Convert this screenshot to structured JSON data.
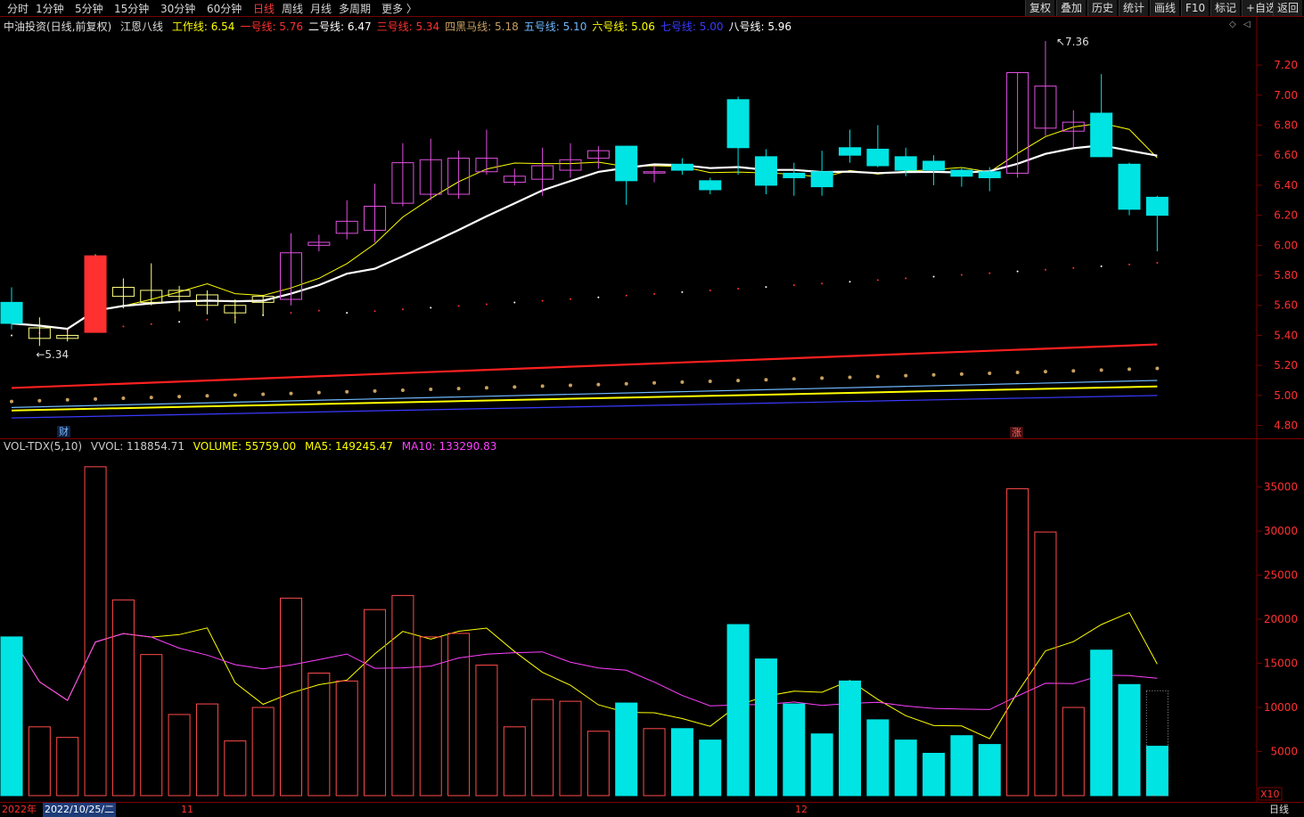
{
  "toolbar": {
    "periods": [
      "分时",
      "1分钟",
      "5分钟",
      "15分钟",
      "30分钟",
      "60分钟",
      "日线",
      "周线",
      "月线",
      "多周期",
      "更多 〉"
    ],
    "active": "日线",
    "right_buttons": [
      "复权",
      "叠加",
      "历史",
      "统计",
      "画线",
      "F10",
      "标记",
      "+自选",
      "返回"
    ]
  },
  "info": {
    "stock": "中油投资(日线,前复权)",
    "indicator": "江恩八线",
    "lines": [
      {
        "label": "工作线:",
        "value": "6.54",
        "color": "#ffff00"
      },
      {
        "label": "一号线:",
        "value": "5.76",
        "color": "#ff3030"
      },
      {
        "label": "二号线:",
        "value": "6.47",
        "color": "#ffffff"
      },
      {
        "label": "三号线:",
        "value": "5.34",
        "color": "#ff3030"
      },
      {
        "label": "四黑马线:",
        "value": "5.18",
        "color": "#c8a060"
      },
      {
        "label": "五号线:",
        "value": "5.10",
        "color": "#6fb8ff"
      },
      {
        "label": "六号线:",
        "value": "5.06",
        "color": "#ffff00"
      },
      {
        "label": "七号线:",
        "value": "5.00",
        "color": "#3a3aff"
      },
      {
        "label": "八号线:",
        "value": "5.96",
        "color": "#ffffff"
      }
    ]
  },
  "volume_info": {
    "name": "VOL-TDX(5,10)",
    "vvol": "VVOL: 118854.71",
    "volume": "VOLUME: 55759.00",
    "ma5": "MA5: 149245.47",
    "ma10": "MA10: 133290.83",
    "colors": {
      "name": "#cccccc",
      "vvol": "#cccccc",
      "volume": "#ffff00",
      "ma5": "#ffff00",
      "ma10": "#ff40ff"
    }
  },
  "annotations": {
    "high": "7.36",
    "low": "5.34",
    "cai": "财",
    "zhang": "涨"
  },
  "price_axis": [
    "7.20",
    "7.00",
    "6.80",
    "6.60",
    "6.40",
    "6.20",
    "6.00",
    "5.80",
    "5.60",
    "5.40",
    "5.20",
    "5.00",
    "4.80"
  ],
  "volume_axis": [
    "35000",
    "30000",
    "25000",
    "20000",
    "15000",
    "10000",
    "5000"
  ],
  "volume_unit": "X10",
  "bottom": {
    "year": "2022年",
    "cursor_date": "2022/10/25/二",
    "m11": "11",
    "m12": "12",
    "period": "日线"
  },
  "colors": {
    "up": "#ff3030",
    "down": "#00e4e4",
    "up_small": "#e050e0",
    "grid": "#7a0000",
    "yellow": "#ffff00",
    "magenta": "#ff40ff"
  },
  "chart_data": {
    "type": "candlestick",
    "ohlc": [
      [
        5.62,
        5.72,
        5.44,
        5.48
      ],
      [
        5.38,
        5.52,
        5.33,
        5.45
      ],
      [
        5.38,
        5.44,
        5.36,
        5.4
      ],
      [
        5.42,
        5.94,
        5.42,
        5.93
      ],
      [
        5.66,
        5.78,
        5.58,
        5.72
      ],
      [
        5.62,
        5.88,
        5.6,
        5.7
      ],
      [
        5.66,
        5.73,
        5.56,
        5.7
      ],
      [
        5.6,
        5.7,
        5.54,
        5.67
      ],
      [
        5.55,
        5.64,
        5.48,
        5.6
      ],
      [
        5.62,
        5.67,
        5.53,
        5.66
      ],
      [
        5.64,
        6.08,
        5.6,
        5.95
      ],
      [
        6.0,
        6.07,
        5.96,
        6.02
      ],
      [
        6.08,
        6.3,
        6.04,
        6.16
      ],
      [
        6.1,
        6.41,
        6.02,
        6.26
      ],
      [
        6.28,
        6.68,
        6.26,
        6.55
      ],
      [
        6.34,
        6.71,
        6.3,
        6.57
      ],
      [
        6.34,
        6.63,
        6.31,
        6.58
      ],
      [
        6.49,
        6.77,
        6.47,
        6.58
      ],
      [
        6.42,
        6.51,
        6.4,
        6.46
      ],
      [
        6.44,
        6.65,
        6.33,
        6.53
      ],
      [
        6.5,
        6.68,
        6.45,
        6.57
      ],
      [
        6.58,
        6.66,
        6.51,
        6.63
      ],
      [
        6.66,
        6.65,
        6.27,
        6.43
      ],
      [
        6.49,
        6.53,
        6.42,
        6.49
      ],
      [
        6.54,
        6.58,
        6.47,
        6.5
      ],
      [
        6.43,
        6.45,
        6.34,
        6.37
      ],
      [
        6.97,
        6.99,
        6.47,
        6.65
      ],
      [
        6.59,
        6.64,
        6.34,
        6.4
      ],
      [
        6.48,
        6.55,
        6.33,
        6.45
      ],
      [
        6.49,
        6.63,
        6.33,
        6.39
      ],
      [
        6.65,
        6.77,
        6.55,
        6.6
      ],
      [
        6.64,
        6.8,
        6.52,
        6.53
      ],
      [
        6.59,
        6.65,
        6.46,
        6.5
      ],
      [
        6.56,
        6.6,
        6.4,
        6.5
      ],
      [
        6.5,
        6.52,
        6.39,
        6.46
      ],
      [
        6.49,
        6.52,
        6.36,
        6.45
      ],
      [
        6.48,
        7.15,
        6.45,
        7.15
      ],
      [
        6.78,
        7.36,
        6.73,
        7.06
      ],
      [
        6.76,
        6.9,
        6.65,
        6.82
      ],
      [
        6.88,
        7.14,
        6.59,
        6.59
      ],
      [
        6.54,
        6.55,
        6.2,
        6.24
      ],
      [
        6.32,
        6.33,
        5.96,
        6.2
      ]
    ],
    "volume": [
      18000,
      7800,
      6600,
      37300,
      22200,
      16000,
      9200,
      10400,
      6200,
      10000,
      22400,
      13900,
      13000,
      21100,
      22700,
      18000,
      18400,
      14800,
      7800,
      10900,
      10700,
      7300,
      10500,
      7600,
      7600,
      6300,
      19400,
      15500,
      10400,
      7000,
      13000,
      8600,
      6300,
      4800,
      6800,
      5800,
      34800,
      29900,
      10000,
      16500,
      12600,
      5600
    ],
    "price_range": [
      4.75,
      7.42
    ],
    "volume_range": [
      0,
      38500
    ]
  }
}
